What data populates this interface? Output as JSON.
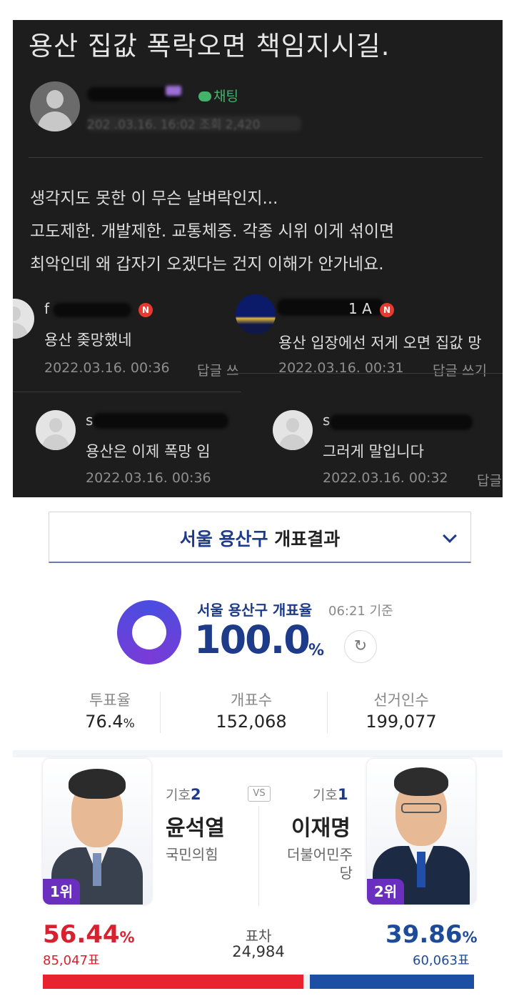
{
  "post": {
    "title": "용산 집값 폭락오면 책임지시길.",
    "chat_label": "채팅",
    "meta_text": "202 .03.16. 16:02 조회 2,420",
    "body_lines": [
      "생각지도 못한 이 무슨 날벼락인지...",
      "고도제한. 개발제한. 교통체증. 각종 시위 이게 섞이면",
      "최악인데 왜 갑자기 오겠다는 건지 이해가 안가네요."
    ]
  },
  "comments": [
    {
      "name": "f",
      "badge": "N",
      "text": "용산 좆망했네",
      "date": "2022.03.16. 00:36",
      "reply": "답글 쓰"
    },
    {
      "name": "1 A",
      "badge": "N",
      "text": "용산 입장에선 저게 오면 집값 망",
      "date": "2022.03.16. 00:31",
      "reply": "답글 쓰기"
    },
    {
      "name": "s",
      "text": "용산은 이제 폭망 임",
      "date": "2022.03.16. 00:36"
    },
    {
      "name": "s",
      "text": "그러게 말입니다",
      "date": "2022.03.16. 00:32",
      "reply": "답글"
    }
  ],
  "election": {
    "dropdown": {
      "region": "서울 용산구",
      "suffix": " 개표결과"
    },
    "count": {
      "label": "서울 용산구 개표율",
      "time": "06:21 기준",
      "rate": "100.0",
      "unit": "%",
      "progress": 1.0,
      "refresh_icon": "refresh-icon"
    },
    "stats": [
      {
        "label": "투표율",
        "value": "76.4",
        "unit": "%"
      },
      {
        "label": "개표수",
        "value": "152,068"
      },
      {
        "label": "선거인수",
        "value": "199,077"
      }
    ],
    "vs_label": "VS",
    "candidates": [
      {
        "symbol_label": "기호",
        "symbol": "2",
        "name": "윤석열",
        "party": "국민의힘",
        "rank": "1위",
        "pct": "56.44",
        "pct_unit": "%",
        "votes": "85,047표",
        "color": "#e8232f"
      },
      {
        "symbol_label": "기호",
        "symbol": "1",
        "name": "이재명",
        "party_line1": "더불어민주",
        "party_line2": "당",
        "rank": "2위",
        "pct": "39.86",
        "pct_unit": "%",
        "votes": "60,063표",
        "color": "#1c4ea3"
      }
    ],
    "gap": {
      "label": "표차",
      "value": "24,984"
    },
    "bar_fractions": {
      "first": 0.5644,
      "second": 0.3986
    }
  }
}
